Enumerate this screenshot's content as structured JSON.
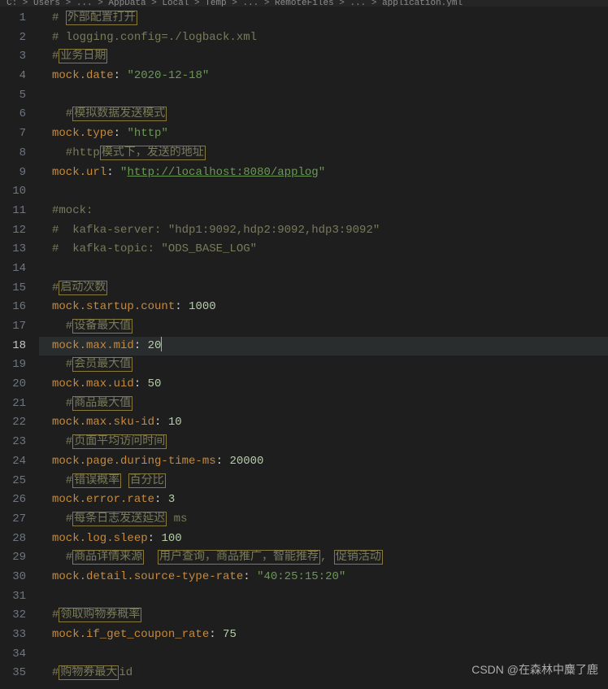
{
  "breadcrumb": "C: > Users > ... > AppData > Local > Temp > ... > RemoteFiles > ... > application.yml",
  "watermark": "CSDN @在森林中麋了鹿",
  "active_line": 18,
  "lines": [
    {
      "n": 1,
      "segs": [
        {
          "t": "# ",
          "c": "comment"
        },
        {
          "t": "外部配置打开",
          "c": "comment",
          "box": true
        }
      ]
    },
    {
      "n": 2,
      "segs": [
        {
          "t": "# logging.config=./logback.xml",
          "c": "comment"
        }
      ]
    },
    {
      "n": 3,
      "segs": [
        {
          "t": "#",
          "c": "comment"
        },
        {
          "t": "业务日期",
          "c": "comment",
          "box": true
        }
      ]
    },
    {
      "n": 4,
      "segs": [
        {
          "t": "mock.date",
          "c": "key"
        },
        {
          "t": ": ",
          "c": "punct"
        },
        {
          "t": "\"2020-12-18\"",
          "c": "string"
        }
      ]
    },
    {
      "n": 5,
      "segs": []
    },
    {
      "n": 6,
      "segs": [
        {
          "t": "  #",
          "c": "comment"
        },
        {
          "t": "模拟数据发送模式",
          "c": "comment",
          "box": true
        }
      ]
    },
    {
      "n": 7,
      "segs": [
        {
          "t": "mock.type",
          "c": "key"
        },
        {
          "t": ": ",
          "c": "punct"
        },
        {
          "t": "\"http\"",
          "c": "string"
        }
      ]
    },
    {
      "n": 8,
      "segs": [
        {
          "t": "  #http",
          "c": "comment"
        },
        {
          "t": "模式下，发送的地址",
          "c": "comment",
          "box": true
        }
      ]
    },
    {
      "n": 9,
      "segs": [
        {
          "t": "mock.url",
          "c": "key"
        },
        {
          "t": ": ",
          "c": "punct"
        },
        {
          "t": "\"",
          "c": "string"
        },
        {
          "t": "http://localhost:8080/applog",
          "c": "url-link"
        },
        {
          "t": "\"",
          "c": "string"
        }
      ]
    },
    {
      "n": 10,
      "segs": []
    },
    {
      "n": 11,
      "segs": [
        {
          "t": "#mock:",
          "c": "comment"
        }
      ]
    },
    {
      "n": 12,
      "segs": [
        {
          "t": "#  kafka-server: \"hdp1:9092,hdp2:9092,hdp3:9092\"",
          "c": "comment"
        }
      ]
    },
    {
      "n": 13,
      "segs": [
        {
          "t": "#  kafka-topic: \"ODS_BASE_LOG\"",
          "c": "comment"
        }
      ]
    },
    {
      "n": 14,
      "segs": []
    },
    {
      "n": 15,
      "segs": [
        {
          "t": "#",
          "c": "comment"
        },
        {
          "t": "启动次数",
          "c": "comment",
          "box": true
        }
      ]
    },
    {
      "n": 16,
      "segs": [
        {
          "t": "mock.startup.count",
          "c": "key"
        },
        {
          "t": ": ",
          "c": "punct"
        },
        {
          "t": "1000",
          "c": "number"
        }
      ]
    },
    {
      "n": 17,
      "segs": [
        {
          "t": "  #",
          "c": "comment"
        },
        {
          "t": "设备最大值",
          "c": "comment",
          "box": true
        }
      ]
    },
    {
      "n": 18,
      "segs": [
        {
          "t": "mock.max.mid",
          "c": "key"
        },
        {
          "t": ": ",
          "c": "punct"
        },
        {
          "t": "20",
          "c": "number"
        },
        {
          "t": "",
          "cursor": true
        }
      ]
    },
    {
      "n": 19,
      "segs": [
        {
          "t": "  #",
          "c": "comment"
        },
        {
          "t": "会员最大值",
          "c": "comment",
          "box": true
        }
      ]
    },
    {
      "n": 20,
      "segs": [
        {
          "t": "mock.max.uid",
          "c": "key"
        },
        {
          "t": ": ",
          "c": "punct"
        },
        {
          "t": "50",
          "c": "number"
        }
      ]
    },
    {
      "n": 21,
      "segs": [
        {
          "t": "  #",
          "c": "comment"
        },
        {
          "t": "商品最大值",
          "c": "comment",
          "box": true
        }
      ]
    },
    {
      "n": 22,
      "segs": [
        {
          "t": "mock.max.sku-id",
          "c": "key"
        },
        {
          "t": ": ",
          "c": "punct"
        },
        {
          "t": "10",
          "c": "number"
        }
      ]
    },
    {
      "n": 23,
      "segs": [
        {
          "t": "  #",
          "c": "comment"
        },
        {
          "t": "页面平均访问时间",
          "c": "comment",
          "box": true
        }
      ]
    },
    {
      "n": 24,
      "segs": [
        {
          "t": "mock.page.during-time-ms",
          "c": "key"
        },
        {
          "t": ": ",
          "c": "punct"
        },
        {
          "t": "20000",
          "c": "number"
        }
      ]
    },
    {
      "n": 25,
      "segs": [
        {
          "t": "  #",
          "c": "comment"
        },
        {
          "t": "错误概率",
          "c": "comment",
          "box": true
        },
        {
          "t": " ",
          "c": "comment"
        },
        {
          "t": "百分比",
          "c": "comment",
          "box": true
        }
      ]
    },
    {
      "n": 26,
      "segs": [
        {
          "t": "mock.error.rate",
          "c": "key"
        },
        {
          "t": ": ",
          "c": "punct"
        },
        {
          "t": "3",
          "c": "number"
        }
      ]
    },
    {
      "n": 27,
      "segs": [
        {
          "t": "  #",
          "c": "comment"
        },
        {
          "t": "每条日志发送延迟",
          "c": "comment",
          "box": true
        },
        {
          "t": " ms",
          "c": "comment"
        }
      ]
    },
    {
      "n": 28,
      "segs": [
        {
          "t": "mock.log.sleep",
          "c": "key"
        },
        {
          "t": ": ",
          "c": "punct"
        },
        {
          "t": "100",
          "c": "number"
        }
      ]
    },
    {
      "n": 29,
      "segs": [
        {
          "t": "  #",
          "c": "comment"
        },
        {
          "t": "商品详情来源",
          "c": "comment",
          "box": true
        },
        {
          "t": "  ",
          "c": "comment"
        },
        {
          "t": "用户查询，商品推广，智能推荐",
          "c": "comment",
          "box": true
        },
        {
          "t": ", ",
          "c": "comment"
        },
        {
          "t": "促销活动",
          "c": "comment",
          "box": true
        }
      ]
    },
    {
      "n": 30,
      "segs": [
        {
          "t": "mock.detail.source-type-rate",
          "c": "key"
        },
        {
          "t": ": ",
          "c": "punct"
        },
        {
          "t": "\"40:25:15:20\"",
          "c": "string"
        }
      ]
    },
    {
      "n": 31,
      "segs": []
    },
    {
      "n": 32,
      "segs": [
        {
          "t": "#",
          "c": "comment"
        },
        {
          "t": "领取购物券概率",
          "c": "comment",
          "box": true
        }
      ]
    },
    {
      "n": 33,
      "segs": [
        {
          "t": "mock.if_get_coupon_rate",
          "c": "key"
        },
        {
          "t": ": ",
          "c": "punct"
        },
        {
          "t": "75",
          "c": "number"
        }
      ]
    },
    {
      "n": 34,
      "segs": []
    },
    {
      "n": 35,
      "segs": [
        {
          "t": "#",
          "c": "comment"
        },
        {
          "t": "购物券最大",
          "c": "comment",
          "box": true
        },
        {
          "t": "id",
          "c": "comment"
        }
      ]
    }
  ]
}
